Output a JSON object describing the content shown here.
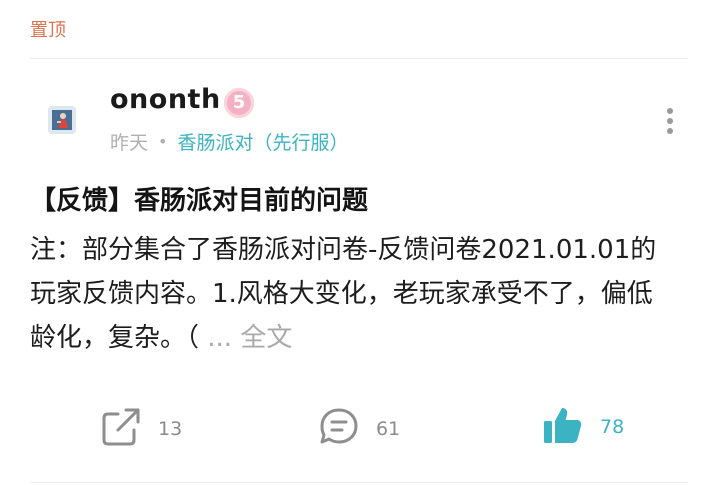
{
  "pinned_label": "置顶",
  "post": {
    "author": "ononth",
    "level": "5",
    "time": "昨天",
    "separator": "•",
    "forum": "香肠派对（先行服）",
    "title": "【反馈】香肠派对目前的问题",
    "body": "注：部分集合了香肠派对问卷-反馈问卷2021.01.01的玩家反馈内容。1.风格大变化，老玩家承受不了，偏低龄化，复杂。（",
    "expand_label": "... 全文"
  },
  "actions": {
    "share_count": "13",
    "comment_count": "61",
    "like_count": "78"
  },
  "colors": {
    "accent": "#3bb3c3",
    "pinned": "#e0734f",
    "badge": "#f4b0c4"
  },
  "icons": {
    "share": "share-icon",
    "comment": "comment-icon",
    "like": "thumbs-up-icon",
    "more": "more-vertical-icon"
  }
}
